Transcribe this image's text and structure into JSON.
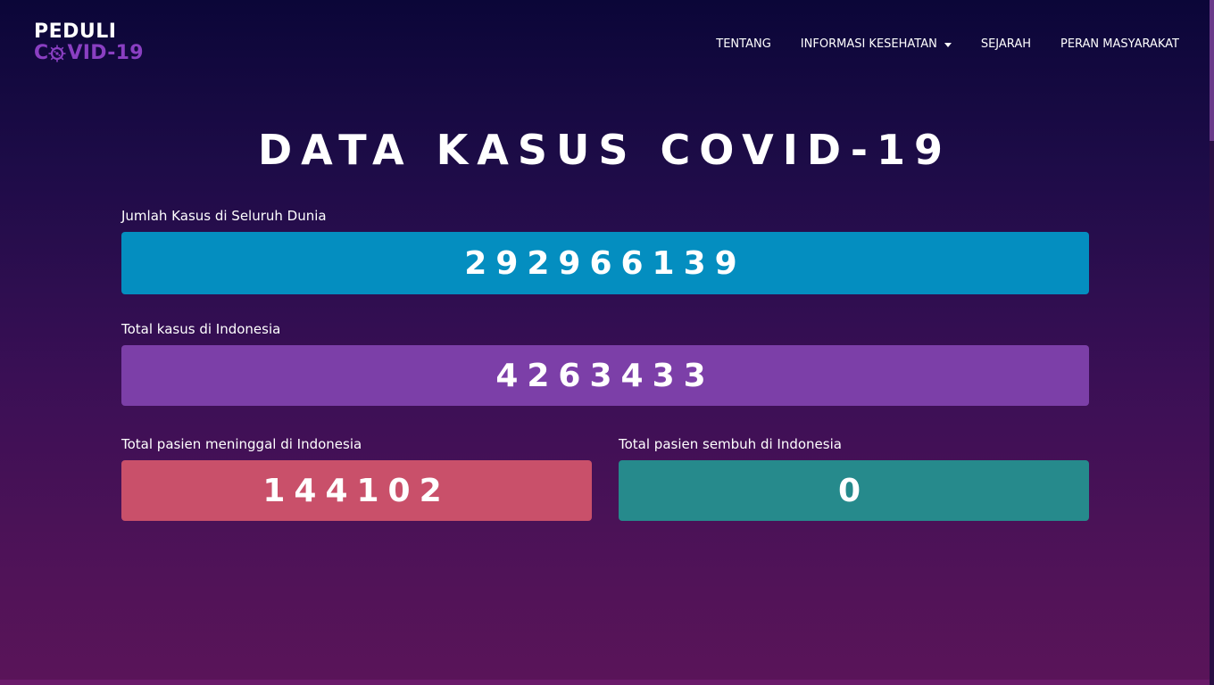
{
  "logo": {
    "line1": "PEDULI",
    "line2_prefix": "C",
    "line2_suffix": "VID-19",
    "icon": "virus-icon"
  },
  "nav": {
    "items": [
      {
        "label": "TENTANG"
      },
      {
        "label": "INFORMASI KESEHATAN",
        "dropdown": true
      },
      {
        "label": "SEJARAH"
      },
      {
        "label": "PERAN MASYARAKAT"
      }
    ]
  },
  "main": {
    "title": "DATA KASUS COVID-19",
    "world": {
      "label": "Jumlah Kasus di Seluruh Dunia",
      "value": "292966139",
      "color": "#048ec0"
    },
    "indonesia_total": {
      "label": "Total kasus di Indonesia",
      "value": "4263433",
      "color": "#7c3fa8"
    },
    "indonesia_deaths": {
      "label": "Total pasien meninggal di Indonesia",
      "value": "144102",
      "color": "#c9506a"
    },
    "indonesia_recovered": {
      "label": "Total pasien sembuh di Indonesia",
      "value": "0",
      "color": "#268a8c"
    }
  }
}
